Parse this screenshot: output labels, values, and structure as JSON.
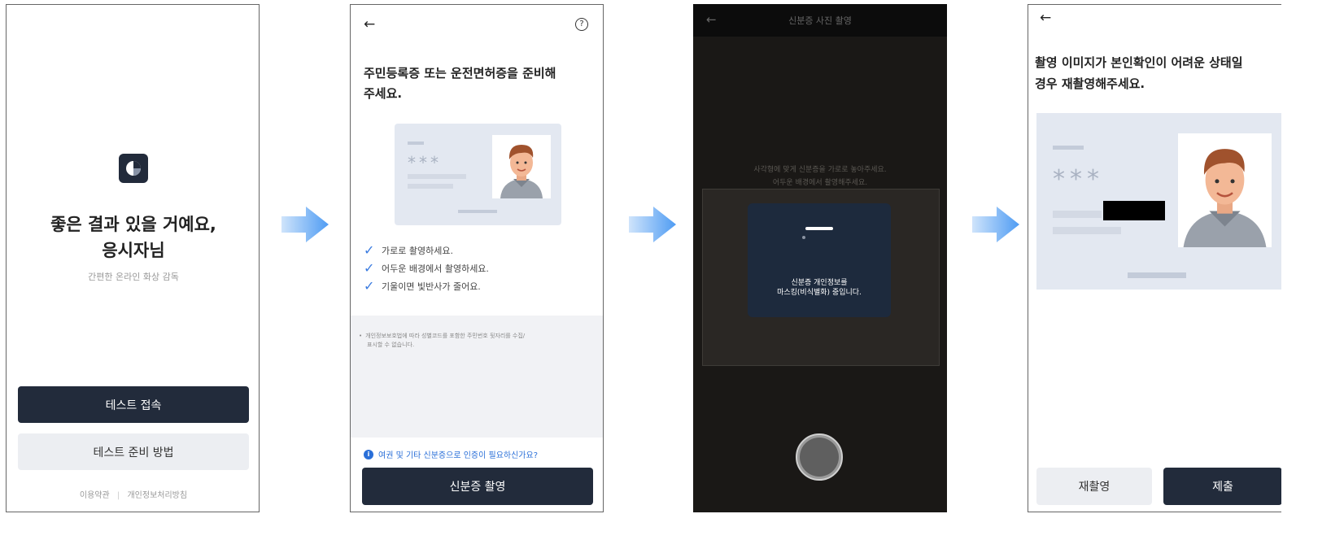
{
  "screen1": {
    "headline_line1": "좋은 결과 있을 거예요,",
    "headline_line2": "응시자님",
    "subtitle": "간편한 온라인 화상 감독",
    "primary_button": "테스트 접속",
    "secondary_button": "테스트 준비 방법",
    "footer_terms": "이용약관",
    "footer_divider": "|",
    "footer_privacy": "개인정보처리방침"
  },
  "screen2": {
    "back_icon": "←",
    "help_icon": "?",
    "title_line1": "주민등록증 또는 운전면허증을 준비해",
    "title_line2": "주세요.",
    "card_mask": "***",
    "checks": [
      "가로로 촬영하세요.",
      "어두운 배경에서 촬영하세요.",
      "기울이면 빛반사가 줄어요."
    ],
    "notice_bullet": "•",
    "notice_line1": "개인정보보호법에 따라 성별코드를 포함한 주민번호 뒷자리를 수집/",
    "notice_line2": "표시할 수 없습니다.",
    "info_icon": "i",
    "help_link": "여권 및 기타 신분증으로 인증이 필요하신가요?",
    "capture_button": "신분증 촬영"
  },
  "screen3": {
    "back_icon": "←",
    "title": "신분증 사진 촬영",
    "guide_line1": "사각형에 맞게 신분증을 가로로 놓아주세요.",
    "guide_line2": "어두운 배경에서 촬영해주세요.",
    "masking_line1": "신분증 개인정보를",
    "masking_line2": "마스킹(비식별화) 중입니다."
  },
  "screen4": {
    "back_icon": "←",
    "title_line1": "촬영 이미지가 본인확인이 어려운 상태일",
    "title_line2": "경우 재촬영해주세요.",
    "card_mask": "***",
    "retake_button": "재촬영",
    "submit_button": "제출"
  },
  "colors": {
    "dark_button": "#222b3b",
    "accent": "#3a7be0",
    "arrow": "#5ba3f5",
    "card": "#e3e8f1"
  }
}
